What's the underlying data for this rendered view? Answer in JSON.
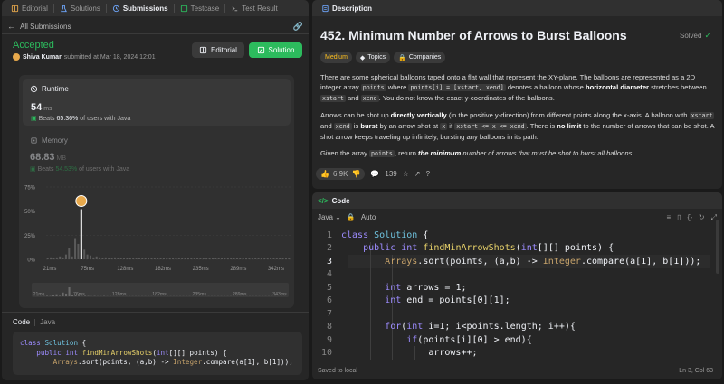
{
  "left_tabs": [
    {
      "label": "Editorial",
      "icon": "book-icon",
      "active": false
    },
    {
      "label": "Solutions",
      "icon": "flask-icon",
      "active": false
    },
    {
      "label": "Submissions",
      "icon": "history-icon",
      "active": true
    },
    {
      "label": "Testcase",
      "icon": "checkbox-icon",
      "active": false
    },
    {
      "label": "Test Result",
      "icon": "terminal-icon",
      "active": false
    }
  ],
  "submission": {
    "back_label": "All Submissions",
    "status": "Accepted",
    "author": "Shiva Kumar",
    "submitted_text": "submitted at Mar 18, 2024 12:01",
    "editorial_button": "Editorial",
    "solution_button": "Solution"
  },
  "runtime": {
    "label": "Runtime",
    "value": "54",
    "unit": "ms",
    "beats_prefix": "Beats",
    "beats_pct": "65.36%",
    "beats_suffix": "of users with Java"
  },
  "memory": {
    "label": "Memory",
    "value": "68.83",
    "unit": "MB",
    "beats_prefix": "Beats",
    "beats_pct": "54.53%",
    "beats_suffix": "of users with Java"
  },
  "chart_data": {
    "type": "bar",
    "title": "",
    "xlabel": "",
    "ylabel": "",
    "ylim": [
      0,
      75
    ],
    "y_ticks": [
      "75%",
      "50%",
      "25%",
      "0%"
    ],
    "x_ticks": [
      "21ms",
      "75ms",
      "128ms",
      "182ms",
      "235ms",
      "289ms",
      "342ms"
    ],
    "mini_x_ticks": [
      "21ms",
      "76ms",
      "128ms",
      "182ms",
      "235ms",
      "289ms",
      "343ms"
    ],
    "values": [
      1,
      2,
      1,
      2,
      3,
      2,
      5,
      12,
      3,
      22,
      16,
      52,
      10,
      5,
      4,
      2,
      3,
      2,
      1,
      2,
      1,
      1,
      2,
      1,
      1,
      1,
      1,
      1,
      1,
      1,
      1,
      1,
      1,
      1,
      1,
      1,
      1,
      1,
      1,
      1,
      1,
      1,
      1,
      1,
      1,
      1,
      1,
      1,
      1,
      1,
      1,
      1,
      1,
      1,
      1,
      1,
      1,
      1,
      1,
      1,
      1,
      1,
      1,
      1,
      1,
      1,
      1,
      1,
      1,
      1,
      1,
      1,
      1,
      1,
      1,
      1,
      1,
      1,
      1,
      1
    ],
    "highlight_index": 11,
    "grid": true
  },
  "code_section": {
    "label": "Code",
    "lang": "Java",
    "snippet": [
      "class Solution {",
      "    public int findMinArrowShots(int[][] points) {",
      "        Arrays.sort(points, (a,b) -> Integer.compare(a[1], b[1]));"
    ]
  },
  "description": {
    "tab_label": "Description",
    "title": "452. Minimum Number of Arrows to Burst Balloons",
    "solved": "Solved",
    "pills": [
      "Medium",
      "Topics",
      "Companies"
    ],
    "p1_a": "There are some spherical balloons taped onto a flat wall that represent the XY-plane. The balloons are represented as a 2D integer array ",
    "p1_code1": "points",
    "p1_b": " where ",
    "p1_code2": "points[i] = [xstart, xend]",
    "p1_c": " denotes a balloon whose ",
    "p1_bold": "horizontal diameter",
    "p1_d": " stretches between ",
    "p1_code3": "xstart",
    "p1_e": " and ",
    "p1_code4": "xend",
    "p1_f": ". You do not know the exact y-coordinates of the balloons.",
    "p2_a": "Arrows can be shot up ",
    "p2_bold1": "directly vertically",
    "p2_b": " (in the positive y-direction) from different points along the x-axis. A balloon with ",
    "p2_code1": "xstart",
    "p2_c": " and ",
    "p2_code2": "xend",
    "p2_d": " is ",
    "p2_bold2": "burst",
    "p2_e": " by an arrow shot at ",
    "p2_code3": "x",
    "p2_f": " if ",
    "p2_code4": "xstart <= x <= xend",
    "p2_g": ". There is ",
    "p2_bold3": "no limit",
    "p2_h": " to the number of arrows that can be shot. A shot arrow keeps traveling up infinitely, bursting any balloons in its path.",
    "p3_a": "Given the array ",
    "p3_code": "points",
    "p3_b": ", return ",
    "p3_em": "the minimum",
    "p3_c": " number of arrows that must be shot to burst all balloons.",
    "likes": "6.9K",
    "comments": "139"
  },
  "editor": {
    "tab_label": "Code",
    "language": "Java",
    "mode": "Auto",
    "status": "Saved to local",
    "cursor": "Ln 3, Col 63",
    "lines": [
      {
        "n": "1",
        "text": "class Solution {"
      },
      {
        "n": "2",
        "text": "    public int findMinArrowShots(int[][] points) {"
      },
      {
        "n": "3",
        "text": "        Arrays.sort(points, (a,b) -> Integer.compare(a[1], b[1]));"
      },
      {
        "n": "4",
        "text": ""
      },
      {
        "n": "5",
        "text": "        int arrows = 1;"
      },
      {
        "n": "6",
        "text": "        int end = points[0][1];"
      },
      {
        "n": "7",
        "text": ""
      },
      {
        "n": "8",
        "text": "        for(int i=1; i<points.length; i++){"
      },
      {
        "n": "9",
        "text": "            if(points[i][0] > end){"
      },
      {
        "n": "10",
        "text": "                arrows++;"
      }
    ]
  },
  "colors": {
    "accent_green": "#2cbb5d",
    "medium_yellow": "#ffc01e",
    "panel_bg": "#262626",
    "page_bg": "#1a1a1a"
  }
}
